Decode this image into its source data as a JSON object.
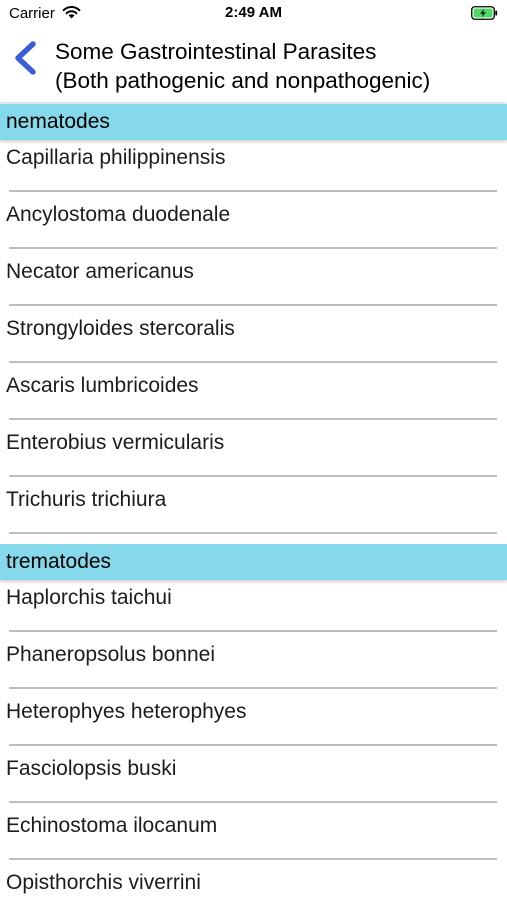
{
  "status_bar": {
    "carrier": "Carrier",
    "time": "2:49 AM",
    "battery_color": "#4cd964"
  },
  "nav": {
    "back_icon": "chevron-left-icon",
    "accent_color": "#3b5ed8",
    "title_line1": "Some Gastrointestinal Parasites",
    "title_line2": "(Both pathogenic and nonpathogenic)"
  },
  "sections": [
    {
      "header": "nematodes",
      "items": [
        "Capillaria philippinensis",
        "Ancylostoma duodenale",
        "Necator americanus",
        "Strongyloides stercoralis",
        "Ascaris lumbricoides",
        "Enterobius vermicularis",
        "Trichuris trichiura"
      ]
    },
    {
      "header": "trematodes",
      "items": [
        "Haplorchis taichui",
        "Phaneropsolus bonnei",
        "Heterophyes heterophyes",
        "Fasciolopsis buski",
        "Echinostoma ilocanum",
        "Opisthorchis viverrini"
      ]
    }
  ],
  "section_header_color": "#86d9ea"
}
